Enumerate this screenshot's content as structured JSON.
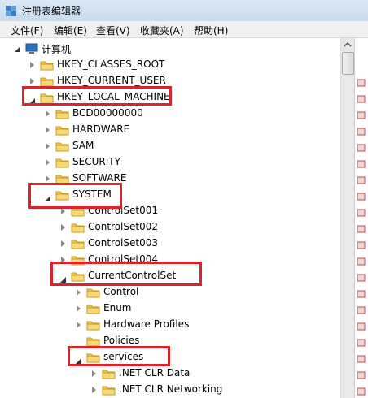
{
  "window": {
    "title": "注册表编辑器"
  },
  "menu": [
    "文件(F)",
    "编辑(E)",
    "查看(V)",
    "收藏夹(A)",
    "帮助(H)"
  ],
  "tree": {
    "root": "计算机",
    "nodes": [
      {
        "label": "HKEY_CLASSES_ROOT"
      },
      {
        "label": "HKEY_CURRENT_USER"
      },
      {
        "label": "HKEY_LOCAL_MACHINE"
      },
      {
        "label": "BCD00000000"
      },
      {
        "label": "HARDWARE"
      },
      {
        "label": "SAM"
      },
      {
        "label": "SECURITY"
      },
      {
        "label": "SOFTWARE"
      },
      {
        "label": "SYSTEM"
      },
      {
        "label": "ControlSet001"
      },
      {
        "label": "ControlSet002"
      },
      {
        "label": "ControlSet003"
      },
      {
        "label": "ControlSet004"
      },
      {
        "label": "CurrentControlSet"
      },
      {
        "label": "Control"
      },
      {
        "label": "Enum"
      },
      {
        "label": "Hardware Profiles"
      },
      {
        "label": "Policies"
      },
      {
        "label": "services"
      },
      {
        "label": ".NET CLR Data"
      },
      {
        "label": ".NET CLR Networking"
      }
    ]
  },
  "colors": {
    "highlight": "#d9222a",
    "folder": "#f2c94c"
  }
}
